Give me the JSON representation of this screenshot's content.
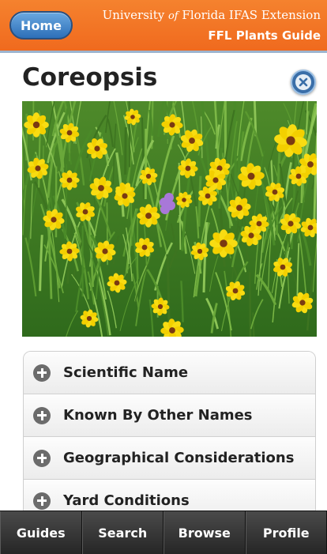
{
  "header": {
    "home_label": "Home",
    "brand_part1": "University",
    "brand_of": "of",
    "brand_part2": "Florida IFAS Extension",
    "app_title": "FFL Plants Guide"
  },
  "page": {
    "title": "Coreopsis",
    "image_alt": "coreopsis-flowers-photo"
  },
  "accordion": {
    "items": [
      {
        "label": "Scientific Name"
      },
      {
        "label": "Known By Other Names"
      },
      {
        "label": "Geographical Considerations"
      },
      {
        "label": "Yard Conditions"
      }
    ]
  },
  "tabbar": {
    "tabs": [
      {
        "label": "Guides"
      },
      {
        "label": "Search"
      },
      {
        "label": "Browse"
      },
      {
        "label": "Profile"
      }
    ]
  },
  "colors": {
    "header_orange": "#f06a1e",
    "home_blue": "#2d6fb8",
    "flower_yellow": "#f5d400",
    "tabbar_dark": "#2a2a2a"
  }
}
